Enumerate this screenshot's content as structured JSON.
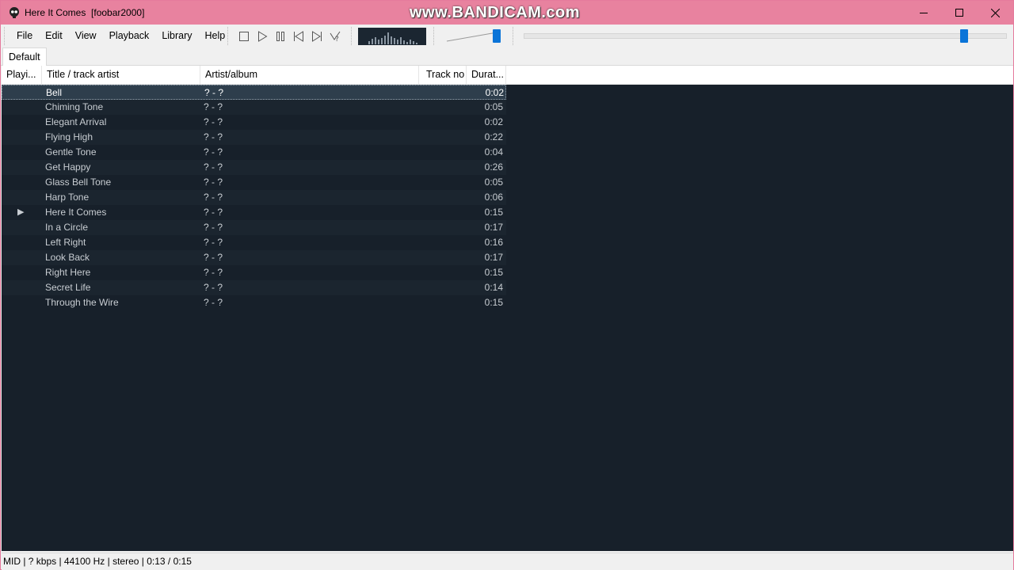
{
  "window": {
    "title": "Here It Comes  [foobar2000]",
    "watermark": "www.BANDICAM.com",
    "accent_color": "#e8829f"
  },
  "menu": [
    "File",
    "Edit",
    "View",
    "Playback",
    "Library",
    "Help"
  ],
  "transport_icons": [
    "stop-icon",
    "play-icon",
    "pause-icon",
    "previous-icon",
    "next-icon",
    "random-icon"
  ],
  "volume_level": 1.0,
  "seek_position": 0.8667,
  "playlist_tab": "Default",
  "columns": {
    "playing": "Playi...",
    "title": "Title / track artist",
    "artist_album": "Artist/album",
    "track_no": "Track no",
    "duration": "Durat..."
  },
  "tracks": [
    {
      "playing": "",
      "title": "Bell",
      "artist_album": "? - ?",
      "duration": "0:02"
    },
    {
      "playing": "",
      "title": "Chiming Tone",
      "artist_album": "? - ?",
      "duration": "0:05"
    },
    {
      "playing": "",
      "title": "Elegant Arrival",
      "artist_album": "? - ?",
      "duration": "0:02"
    },
    {
      "playing": "",
      "title": "Flying High",
      "artist_album": "? - ?",
      "duration": "0:22"
    },
    {
      "playing": "",
      "title": "Gentle Tone",
      "artist_album": "? - ?",
      "duration": "0:04"
    },
    {
      "playing": "",
      "title": "Get Happy",
      "artist_album": "? - ?",
      "duration": "0:26"
    },
    {
      "playing": "",
      "title": "Glass Bell Tone",
      "artist_album": "? - ?",
      "duration": "0:05"
    },
    {
      "playing": "",
      "title": "Harp Tone",
      "artist_album": "? - ?",
      "duration": "0:06"
    },
    {
      "playing": "▶",
      "title": "Here It Comes",
      "artist_album": "? - ?",
      "duration": "0:15"
    },
    {
      "playing": "",
      "title": "In a Circle",
      "artist_album": "? - ?",
      "duration": "0:17"
    },
    {
      "playing": "",
      "title": "Left Right",
      "artist_album": "? - ?",
      "duration": "0:16"
    },
    {
      "playing": "",
      "title": "Look Back",
      "artist_album": "? - ?",
      "duration": "0:17"
    },
    {
      "playing": "",
      "title": "Right Here",
      "artist_album": "? - ?",
      "duration": "0:15"
    },
    {
      "playing": "",
      "title": "Secret Life",
      "artist_album": "? - ?",
      "duration": "0:14"
    },
    {
      "playing": "",
      "title": "Through the Wire",
      "artist_album": "? - ?",
      "duration": "0:15"
    }
  ],
  "status": "MID | ? kbps | 44100 Hz | stereo | 0:13 / 0:15"
}
